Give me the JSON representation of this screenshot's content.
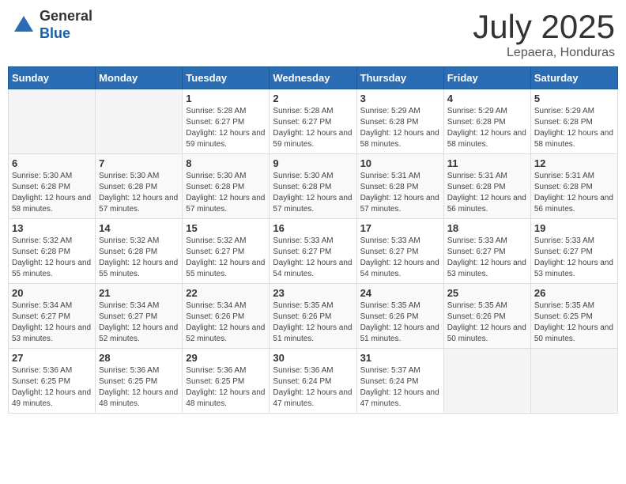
{
  "logo": {
    "general": "General",
    "blue": "Blue"
  },
  "header": {
    "month": "July 2025",
    "location": "Lepaera, Honduras"
  },
  "weekdays": [
    "Sunday",
    "Monday",
    "Tuesday",
    "Wednesday",
    "Thursday",
    "Friday",
    "Saturday"
  ],
  "weeks": [
    [
      {
        "day": "",
        "empty": true
      },
      {
        "day": "",
        "empty": true
      },
      {
        "day": "1",
        "sunrise": "Sunrise: 5:28 AM",
        "sunset": "Sunset: 6:27 PM",
        "daylight": "Daylight: 12 hours and 59 minutes."
      },
      {
        "day": "2",
        "sunrise": "Sunrise: 5:28 AM",
        "sunset": "Sunset: 6:27 PM",
        "daylight": "Daylight: 12 hours and 59 minutes."
      },
      {
        "day": "3",
        "sunrise": "Sunrise: 5:29 AM",
        "sunset": "Sunset: 6:28 PM",
        "daylight": "Daylight: 12 hours and 58 minutes."
      },
      {
        "day": "4",
        "sunrise": "Sunrise: 5:29 AM",
        "sunset": "Sunset: 6:28 PM",
        "daylight": "Daylight: 12 hours and 58 minutes."
      },
      {
        "day": "5",
        "sunrise": "Sunrise: 5:29 AM",
        "sunset": "Sunset: 6:28 PM",
        "daylight": "Daylight: 12 hours and 58 minutes."
      }
    ],
    [
      {
        "day": "6",
        "sunrise": "Sunrise: 5:30 AM",
        "sunset": "Sunset: 6:28 PM",
        "daylight": "Daylight: 12 hours and 58 minutes."
      },
      {
        "day": "7",
        "sunrise": "Sunrise: 5:30 AM",
        "sunset": "Sunset: 6:28 PM",
        "daylight": "Daylight: 12 hours and 57 minutes."
      },
      {
        "day": "8",
        "sunrise": "Sunrise: 5:30 AM",
        "sunset": "Sunset: 6:28 PM",
        "daylight": "Daylight: 12 hours and 57 minutes."
      },
      {
        "day": "9",
        "sunrise": "Sunrise: 5:30 AM",
        "sunset": "Sunset: 6:28 PM",
        "daylight": "Daylight: 12 hours and 57 minutes."
      },
      {
        "day": "10",
        "sunrise": "Sunrise: 5:31 AM",
        "sunset": "Sunset: 6:28 PM",
        "daylight": "Daylight: 12 hours and 57 minutes."
      },
      {
        "day": "11",
        "sunrise": "Sunrise: 5:31 AM",
        "sunset": "Sunset: 6:28 PM",
        "daylight": "Daylight: 12 hours and 56 minutes."
      },
      {
        "day": "12",
        "sunrise": "Sunrise: 5:31 AM",
        "sunset": "Sunset: 6:28 PM",
        "daylight": "Daylight: 12 hours and 56 minutes."
      }
    ],
    [
      {
        "day": "13",
        "sunrise": "Sunrise: 5:32 AM",
        "sunset": "Sunset: 6:28 PM",
        "daylight": "Daylight: 12 hours and 55 minutes."
      },
      {
        "day": "14",
        "sunrise": "Sunrise: 5:32 AM",
        "sunset": "Sunset: 6:28 PM",
        "daylight": "Daylight: 12 hours and 55 minutes."
      },
      {
        "day": "15",
        "sunrise": "Sunrise: 5:32 AM",
        "sunset": "Sunset: 6:27 PM",
        "daylight": "Daylight: 12 hours and 55 minutes."
      },
      {
        "day": "16",
        "sunrise": "Sunrise: 5:33 AM",
        "sunset": "Sunset: 6:27 PM",
        "daylight": "Daylight: 12 hours and 54 minutes."
      },
      {
        "day": "17",
        "sunrise": "Sunrise: 5:33 AM",
        "sunset": "Sunset: 6:27 PM",
        "daylight": "Daylight: 12 hours and 54 minutes."
      },
      {
        "day": "18",
        "sunrise": "Sunrise: 5:33 AM",
        "sunset": "Sunset: 6:27 PM",
        "daylight": "Daylight: 12 hours and 53 minutes."
      },
      {
        "day": "19",
        "sunrise": "Sunrise: 5:33 AM",
        "sunset": "Sunset: 6:27 PM",
        "daylight": "Daylight: 12 hours and 53 minutes."
      }
    ],
    [
      {
        "day": "20",
        "sunrise": "Sunrise: 5:34 AM",
        "sunset": "Sunset: 6:27 PM",
        "daylight": "Daylight: 12 hours and 53 minutes."
      },
      {
        "day": "21",
        "sunrise": "Sunrise: 5:34 AM",
        "sunset": "Sunset: 6:27 PM",
        "daylight": "Daylight: 12 hours and 52 minutes."
      },
      {
        "day": "22",
        "sunrise": "Sunrise: 5:34 AM",
        "sunset": "Sunset: 6:26 PM",
        "daylight": "Daylight: 12 hours and 52 minutes."
      },
      {
        "day": "23",
        "sunrise": "Sunrise: 5:35 AM",
        "sunset": "Sunset: 6:26 PM",
        "daylight": "Daylight: 12 hours and 51 minutes."
      },
      {
        "day": "24",
        "sunrise": "Sunrise: 5:35 AM",
        "sunset": "Sunset: 6:26 PM",
        "daylight": "Daylight: 12 hours and 51 minutes."
      },
      {
        "day": "25",
        "sunrise": "Sunrise: 5:35 AM",
        "sunset": "Sunset: 6:26 PM",
        "daylight": "Daylight: 12 hours and 50 minutes."
      },
      {
        "day": "26",
        "sunrise": "Sunrise: 5:35 AM",
        "sunset": "Sunset: 6:25 PM",
        "daylight": "Daylight: 12 hours and 50 minutes."
      }
    ],
    [
      {
        "day": "27",
        "sunrise": "Sunrise: 5:36 AM",
        "sunset": "Sunset: 6:25 PM",
        "daylight": "Daylight: 12 hours and 49 minutes."
      },
      {
        "day": "28",
        "sunrise": "Sunrise: 5:36 AM",
        "sunset": "Sunset: 6:25 PM",
        "daylight": "Daylight: 12 hours and 48 minutes."
      },
      {
        "day": "29",
        "sunrise": "Sunrise: 5:36 AM",
        "sunset": "Sunset: 6:25 PM",
        "daylight": "Daylight: 12 hours and 48 minutes."
      },
      {
        "day": "30",
        "sunrise": "Sunrise: 5:36 AM",
        "sunset": "Sunset: 6:24 PM",
        "daylight": "Daylight: 12 hours and 47 minutes."
      },
      {
        "day": "31",
        "sunrise": "Sunrise: 5:37 AM",
        "sunset": "Sunset: 6:24 PM",
        "daylight": "Daylight: 12 hours and 47 minutes."
      },
      {
        "day": "",
        "empty": true
      },
      {
        "day": "",
        "empty": true
      }
    ]
  ]
}
